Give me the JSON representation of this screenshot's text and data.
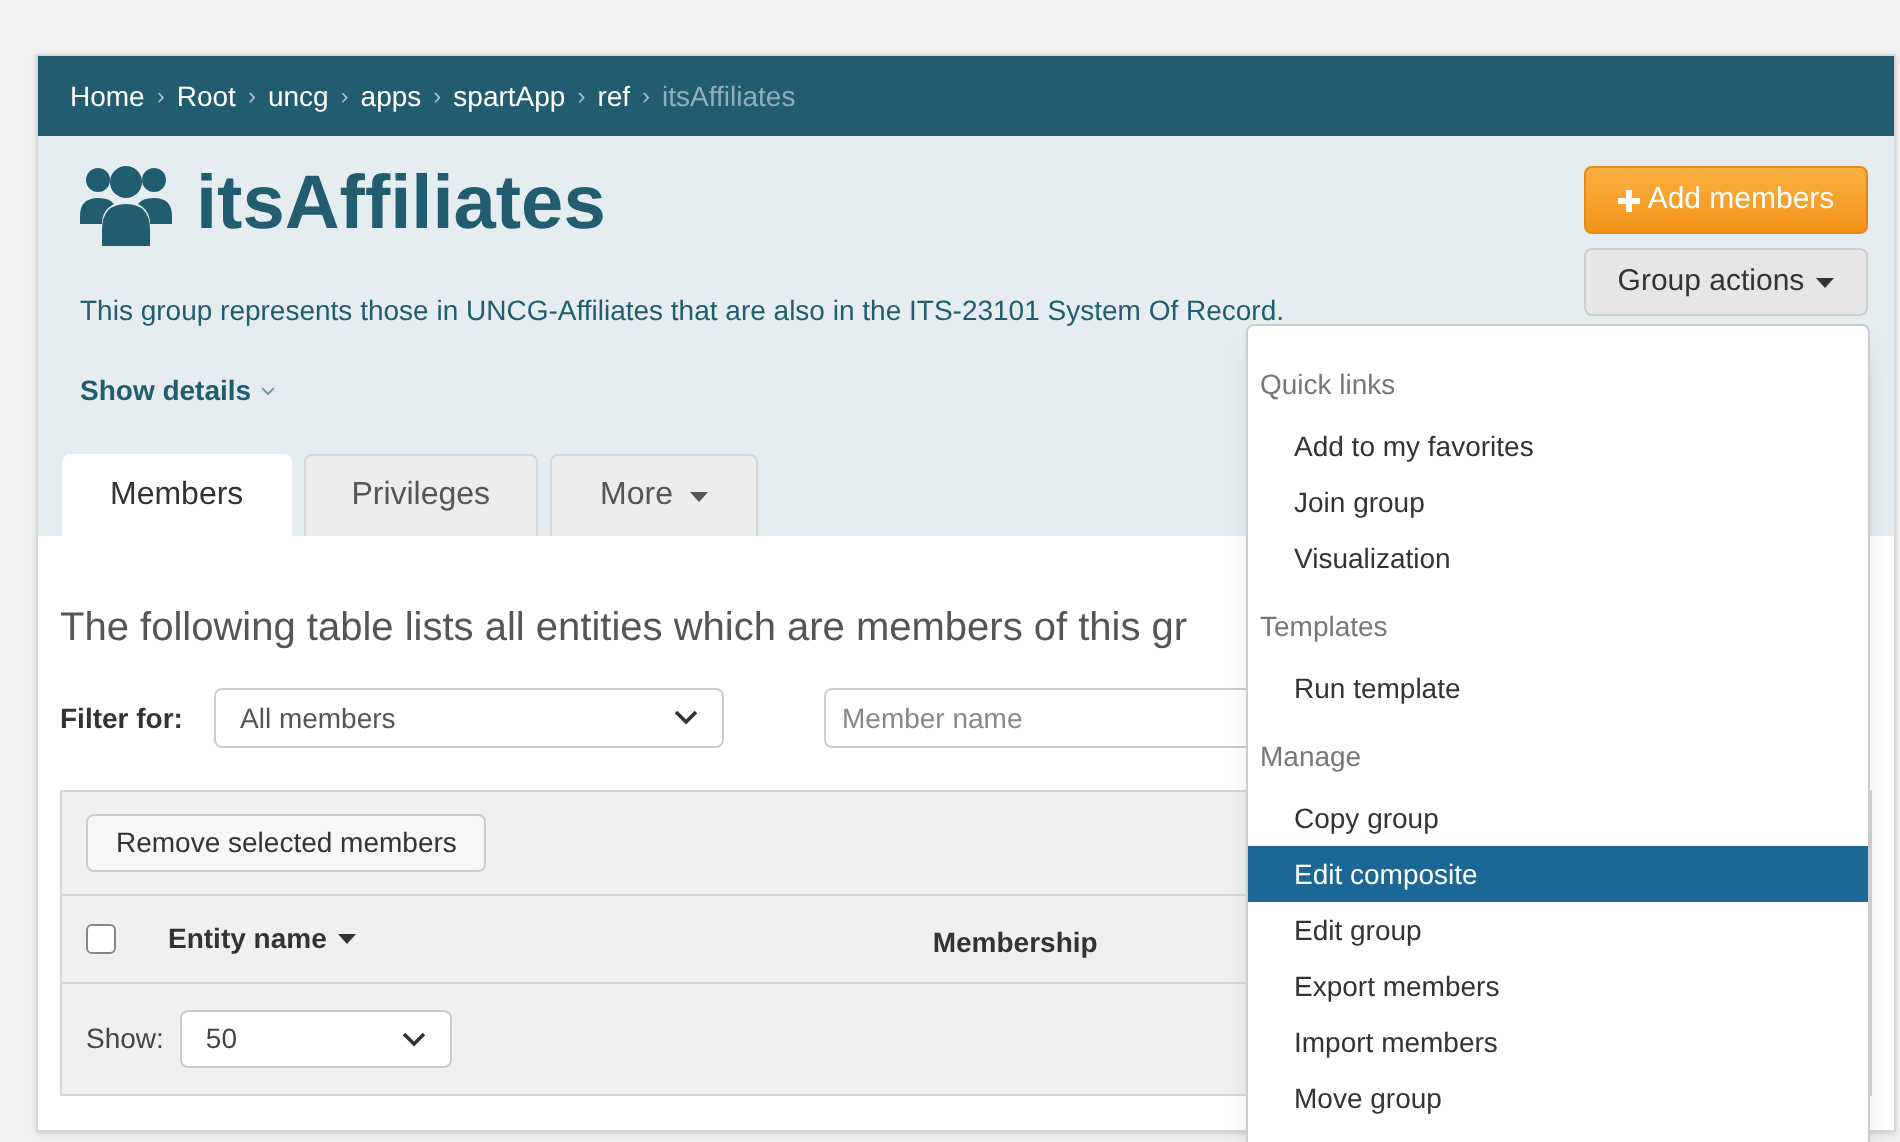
{
  "breadcrumb": [
    {
      "label": "Home",
      "current": false
    },
    {
      "separator": "›",
      "label": "Root",
      "current": false
    },
    {
      "separator": "›",
      "label": "uncg",
      "current": false
    },
    {
      "separator": "›",
      "label": "apps",
      "current": false
    },
    {
      "separator": "›",
      "label": "spartApp",
      "current": false
    },
    {
      "separator": "›",
      "label": "ref",
      "current": false
    },
    {
      "separator": "›",
      "label": "itsAffiliates",
      "current": true
    }
  ],
  "title": "itsAffiliates",
  "description": "This group represents those in UNCG-Affiliates that are also in the ITS-23101 System Of Record.",
  "show_details": "Show details",
  "buttons": {
    "add": "Add members",
    "actions": "Group actions"
  },
  "tabs": [
    {
      "label": "Members",
      "selected": true,
      "caret": false
    },
    {
      "label": "Privileges",
      "selected": false,
      "caret": false
    },
    {
      "label": "More",
      "selected": false,
      "caret": true
    }
  ],
  "intro": "The following table lists all entities which are members of this gr",
  "filter": {
    "label": "Filter for:",
    "value": "All members",
    "placeholder": "Member name"
  },
  "remove_button": "Remove selected members",
  "table": {
    "select_all_checked": false,
    "columns": [
      "Entity name",
      "Membership"
    ]
  },
  "show": {
    "label": "Show:",
    "value": "50"
  },
  "menu": [
    {
      "header": "Quick links",
      "items": [
        {
          "label": "Add to my favorites",
          "selected": false
        },
        {
          "label": "Join group",
          "selected": false
        },
        {
          "label": "Visualization",
          "selected": false
        }
      ]
    },
    {
      "header": "Templates",
      "items": [
        {
          "label": "Run template",
          "selected": false
        }
      ]
    },
    {
      "header": "Manage",
      "items": [
        {
          "label": "Copy group",
          "selected": false
        },
        {
          "label": "Edit composite",
          "selected": true
        },
        {
          "label": "Edit group",
          "selected": false
        },
        {
          "label": "Export members",
          "selected": false
        },
        {
          "label": "Import members",
          "selected": false
        },
        {
          "label": "Move group",
          "selected": false
        }
      ]
    }
  ]
}
